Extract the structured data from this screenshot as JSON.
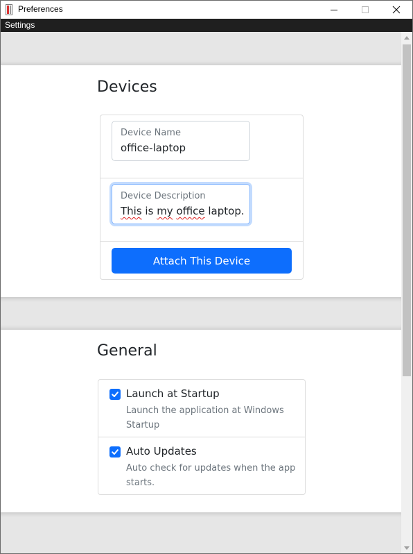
{
  "window": {
    "title": "Preferences"
  },
  "menubar": {
    "items": [
      "Settings"
    ]
  },
  "devices": {
    "title": "Devices",
    "device_name": {
      "label": "Device Name",
      "value": "office-laptop"
    },
    "device_description": {
      "label": "Device Description",
      "value_parts": [
        "This",
        " is ",
        "my",
        " ",
        "office",
        " laptop."
      ]
    },
    "attach_button": "Attach This Device"
  },
  "general": {
    "title": "General",
    "options": [
      {
        "label": "Launch at Startup",
        "help": "Launch the application at Windows Startup",
        "checked": true
      },
      {
        "label": "Auto Updates",
        "help": "Auto check for updates when the app starts.",
        "checked": true
      }
    ]
  },
  "colors": {
    "accent": "#0d6efd",
    "menubar": "#1f1f1f",
    "band": "#e6e6e6"
  },
  "icons": {
    "app": "app-icon",
    "minimize": "minimize-icon",
    "maximize": "maximize-icon",
    "close": "close-icon",
    "check": "checkmark-icon",
    "scroll_up": "chevron-up-icon",
    "scroll_down": "chevron-down-icon"
  }
}
